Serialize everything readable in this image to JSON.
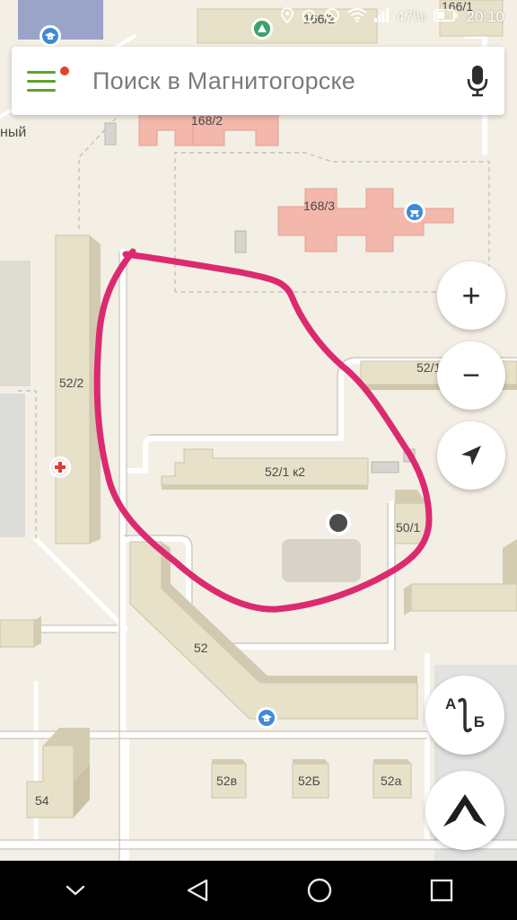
{
  "status_bar": {
    "icons": [
      "location-icon",
      "alarm-icon",
      "silent-icon",
      "wifi-icon",
      "signal-icon",
      "battery-icon"
    ],
    "battery": "47%",
    "time": "20:10"
  },
  "search": {
    "placeholder": "Поиск в Магнитогорске",
    "menu_icon": "hamburger-icon",
    "mic_icon": "microphone-icon"
  },
  "map": {
    "building_labels": [
      "166/1",
      "166/2",
      "168/2",
      "168/3",
      "52/2",
      "52/1 к1",
      "52/1 к2",
      "50/1",
      "52",
      "52в",
      "52Б",
      "52а",
      "54"
    ],
    "street_fragment": "ный",
    "colors": {
      "background": "#f3efe4",
      "building": "#e8e1c9",
      "building_pink": "#f3b7ac",
      "highlight_stroke": "#dc2a70",
      "pin": "#4c4c4c"
    },
    "poi_icons": [
      "school-icon",
      "school-icon",
      "school-icon",
      "kindergarten-icon",
      "hospital-icon",
      "user-location-dot"
    ]
  },
  "controls": {
    "zoom_in": "+",
    "zoom_out": "−",
    "locate_icon": "navigation-arrow-icon",
    "route_icon": "route-a-b-icon",
    "route_a": "А",
    "route_b": "Б",
    "navigator_icon": "navigator-icon"
  },
  "nav_bar": {
    "buttons": [
      "collapse-icon",
      "back-icon",
      "home-icon",
      "recents-icon"
    ]
  }
}
